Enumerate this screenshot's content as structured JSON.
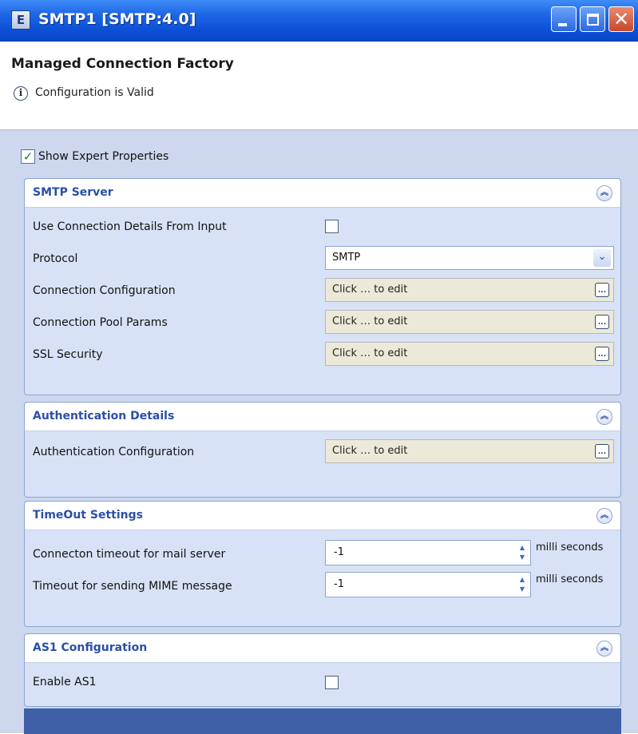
{
  "window": {
    "title": "SMTP1 [SMTP:4.0]",
    "app_icon_glyph": "E"
  },
  "header": {
    "title": "Managed Connection Factory",
    "status": "Configuration is Valid",
    "info_glyph": "i"
  },
  "expert": {
    "label": "Show Expert Properties",
    "checked": true
  },
  "sections": {
    "smtp": {
      "title": "SMTP Server",
      "use_details_label": "Use Connection Details From Input",
      "protocol_label": "Protocol",
      "protocol_value": "SMTP",
      "conn_config_label": "Connection Configuration",
      "conn_config_value": "Click … to edit",
      "pool_label": "Connection Pool Params",
      "pool_value": "Click … to edit",
      "ssl_label": "SSL Security",
      "ssl_value": "Click … to edit"
    },
    "auth": {
      "title": "Authentication Details",
      "config_label": "Authentication Configuration",
      "config_value": "Click … to edit"
    },
    "timeout": {
      "title": "TimeOut Settings",
      "conn_label": "Connecton timeout for mail server",
      "conn_value": "-1",
      "conn_unit": "milli seconds",
      "mime_label": "Timeout for sending MIME message",
      "mime_value": "-1",
      "mime_unit": "milli seconds"
    },
    "as1": {
      "title": "AS1 Configuration",
      "enable_label": "Enable AS1"
    }
  },
  "glyphs": {
    "collapse": "︽",
    "dropdown": "⌄",
    "ellipsis": "...",
    "check": "✓",
    "spin_up": "▲",
    "spin_down": "▼"
  },
  "colors": {
    "title_bar": "#1f67e6",
    "section_title": "#2a4fa7",
    "panel_bg": "#cdd8ee",
    "edit_bg": "#ece9d8"
  }
}
